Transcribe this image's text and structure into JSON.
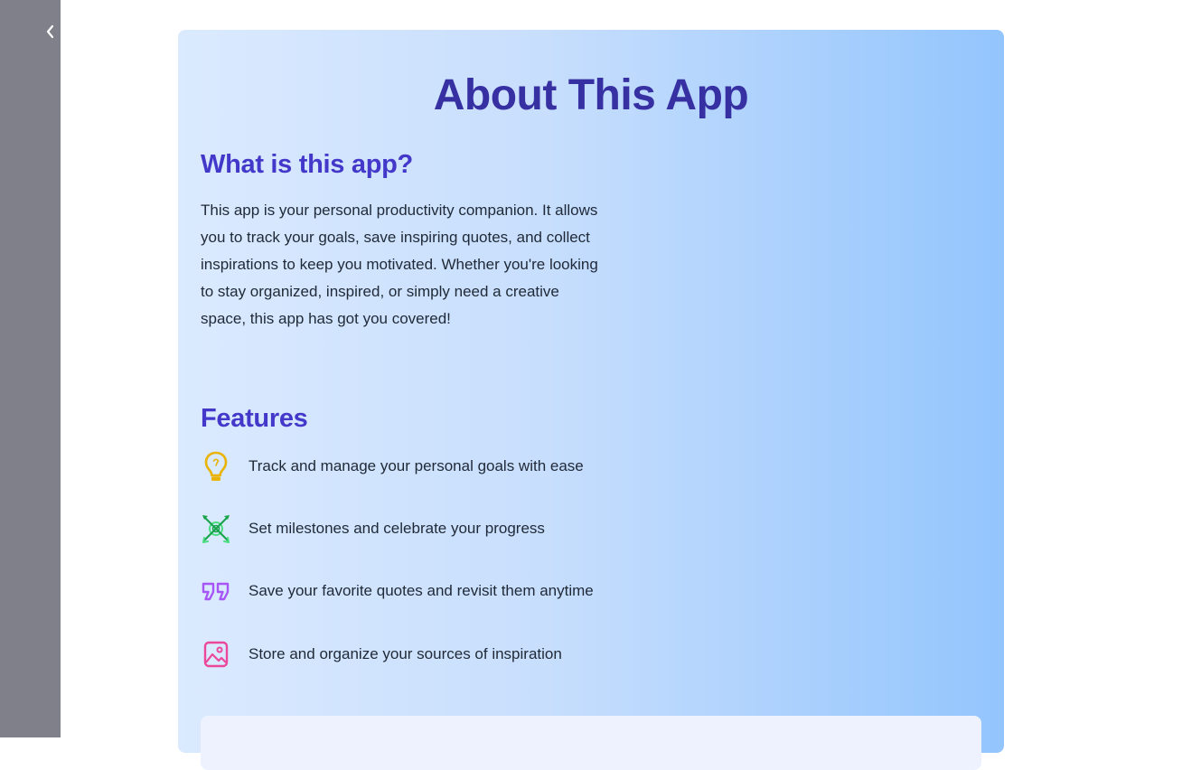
{
  "sidebar": {
    "collapse_icon": "chevron-left-icon"
  },
  "about": {
    "title": "About This App",
    "what_heading": "What is this app?",
    "description": "This app is your personal productivity companion. It allows you to track your goals, save inspiring quotes, and collect inspirations to keep you motivated. Whether you're looking to stay organized, inspired, or simply need a creative space, this app has got you covered!",
    "features_heading": "Features",
    "features": [
      {
        "icon": "lightbulb-icon",
        "color": "#eab308",
        "label": "Track and manage your personal goals with ease"
      },
      {
        "icon": "target-arrows-icon",
        "color": "#22c55e",
        "label": "Set milestones and celebrate your progress"
      },
      {
        "icon": "quote-icon",
        "color": "#a855f7",
        "label": "Save your favorite quotes and revisit them anytime"
      },
      {
        "icon": "image-icon",
        "color": "#ec4899",
        "label": "Store and organize your sources of inspiration"
      }
    ]
  },
  "colors": {
    "sidebar_bg": "#80808b",
    "title": "#3730a3",
    "heading": "#4338ca",
    "body_text": "#1f2937",
    "card_gradient_start": "#dbeafe",
    "card_gradient_end": "#93c5fd",
    "panel_bg": "#eef2ff"
  }
}
